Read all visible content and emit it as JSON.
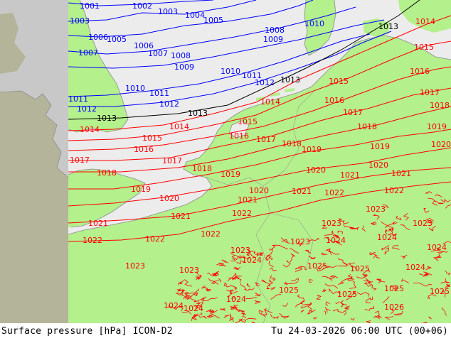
{
  "title": "Surface pressure [hPa]",
  "model": "ICON-D2",
  "valid_time": "Tu 24-03-2026 06:00 UTC (00+06)",
  "colors": {
    "sea": "#ececec",
    "land": "#b4f08c",
    "offgrid": "#c8c8c8",
    "offgrid_land": "#b4b49a",
    "coast": "#8c8c8c",
    "isobar_low": "#0000ff",
    "isobar_ref": "#000000",
    "isobar_high": "#ff0000"
  },
  "isobar_labels": [
    {
      "text": "1001",
      "color": "blue"
    },
    {
      "text": "1002",
      "color": "blue"
    },
    {
      "text": "1003",
      "color": "blue"
    },
    {
      "text": "1003",
      "color": "blue"
    },
    {
      "text": "1004",
      "color": "blue"
    },
    {
      "text": "1005",
      "color": "blue"
    },
    {
      "text": "1005",
      "color": "blue"
    },
    {
      "text": "1006",
      "color": "blue"
    },
    {
      "text": "1006",
      "color": "blue"
    },
    {
      "text": "1007",
      "color": "blue"
    },
    {
      "text": "1007",
      "color": "blue"
    },
    {
      "text": "1008",
      "color": "blue"
    },
    {
      "text": "1008",
      "color": "blue"
    },
    {
      "text": "1009",
      "color": "blue"
    },
    {
      "text": "1009",
      "color": "blue"
    },
    {
      "text": "1010",
      "color": "blue"
    },
    {
      "text": "1010",
      "color": "blue"
    },
    {
      "text": "1011",
      "color": "blue"
    },
    {
      "text": "1011",
      "color": "blue"
    },
    {
      "text": "1011",
      "color": "blue"
    },
    {
      "text": "1012",
      "color": "blue"
    },
    {
      "text": "1012",
      "color": "blue"
    },
    {
      "text": "1012",
      "color": "blue"
    },
    {
      "text": "1010",
      "color": "blue"
    },
    {
      "text": "1013",
      "color": "black"
    },
    {
      "text": "1013",
      "color": "black"
    },
    {
      "text": "1013",
      "color": "black"
    },
    {
      "text": "1013",
      "color": "black"
    },
    {
      "text": "1014",
      "color": "red"
    },
    {
      "text": "1014",
      "color": "red"
    },
    {
      "text": "1014",
      "color": "red"
    },
    {
      "text": "1014",
      "color": "red"
    },
    {
      "text": "1015",
      "color": "red"
    },
    {
      "text": "1015",
      "color": "red"
    },
    {
      "text": "1015",
      "color": "red"
    },
    {
      "text": "1015",
      "color": "red"
    },
    {
      "text": "1016",
      "color": "red"
    },
    {
      "text": "1016",
      "color": "red"
    },
    {
      "text": "1016",
      "color": "red"
    },
    {
      "text": "1016",
      "color": "red"
    },
    {
      "text": "1017",
      "color": "red"
    },
    {
      "text": "1017",
      "color": "red"
    },
    {
      "text": "1017",
      "color": "red"
    },
    {
      "text": "1017",
      "color": "red"
    },
    {
      "text": "1017",
      "color": "red"
    },
    {
      "text": "1018",
      "color": "red"
    },
    {
      "text": "1018",
      "color": "red"
    },
    {
      "text": "1018",
      "color": "red"
    },
    {
      "text": "1018",
      "color": "red"
    },
    {
      "text": "1018",
      "color": "red"
    },
    {
      "text": "1019",
      "color": "red"
    },
    {
      "text": "1019",
      "color": "red"
    },
    {
      "text": "1019",
      "color": "red"
    },
    {
      "text": "1019",
      "color": "red"
    },
    {
      "text": "1019",
      "color": "red"
    },
    {
      "text": "1020",
      "color": "red"
    },
    {
      "text": "1020",
      "color": "red"
    },
    {
      "text": "1020",
      "color": "red"
    },
    {
      "text": "1020",
      "color": "red"
    },
    {
      "text": "1020",
      "color": "red"
    },
    {
      "text": "1021",
      "color": "red"
    },
    {
      "text": "1021",
      "color": "red"
    },
    {
      "text": "1021",
      "color": "red"
    },
    {
      "text": "1021",
      "color": "red"
    },
    {
      "text": "1021",
      "color": "red"
    },
    {
      "text": "1021",
      "color": "red"
    },
    {
      "text": "1022",
      "color": "red"
    },
    {
      "text": "1022",
      "color": "red"
    },
    {
      "text": "1022",
      "color": "red"
    },
    {
      "text": "1022",
      "color": "red"
    },
    {
      "text": "1022",
      "color": "red"
    },
    {
      "text": "1022",
      "color": "red"
    },
    {
      "text": "1023",
      "color": "red"
    },
    {
      "text": "1023",
      "color": "red"
    },
    {
      "text": "1023",
      "color": "red"
    },
    {
      "text": "1023",
      "color": "red"
    },
    {
      "text": "1023",
      "color": "red"
    },
    {
      "text": "1023",
      "color": "red"
    },
    {
      "text": "1023",
      "color": "red"
    },
    {
      "text": "1024",
      "color": "red"
    },
    {
      "text": "1024",
      "color": "red"
    },
    {
      "text": "1024",
      "color": "red"
    },
    {
      "text": "1024",
      "color": "red"
    },
    {
      "text": "1024",
      "color": "red"
    },
    {
      "text": "1024",
      "color": "red"
    },
    {
      "text": "1024",
      "color": "red"
    },
    {
      "text": "1024",
      "color": "red"
    },
    {
      "text": "1025",
      "color": "red"
    },
    {
      "text": "1025",
      "color": "red"
    },
    {
      "text": "1025",
      "color": "red"
    },
    {
      "text": "1025",
      "color": "red"
    },
    {
      "text": "1025",
      "color": "red"
    },
    {
      "text": "1025",
      "color": "red"
    },
    {
      "text": "1026",
      "color": "red"
    }
  ]
}
